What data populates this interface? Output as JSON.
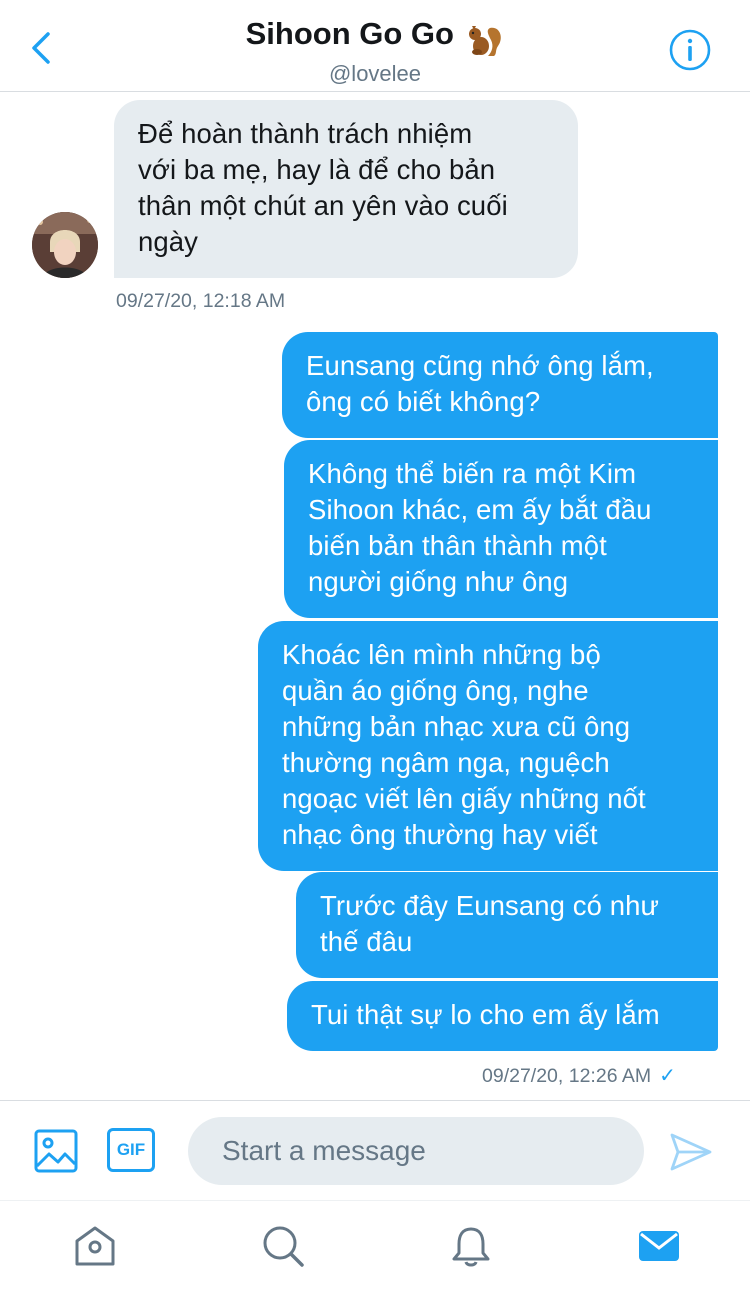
{
  "header": {
    "title": "Sihoon Go Go",
    "title_emoji": "squirrel-emoji",
    "handle": "@lovelee",
    "back_icon": "chevron-left-icon",
    "info_icon": "info-icon"
  },
  "colors": {
    "accent": "#1da1f2",
    "received_bubble": "#e6ecf0",
    "muted_text": "#657786"
  },
  "conversation": {
    "received": [
      {
        "text": "Để hoàn thành trách nhiệm\nvới ba mẹ, hay là để cho bản\nthân một chút an yên vào cuối\nngày"
      }
    ],
    "received_timestamp": "09/27/20, 12:18 AM",
    "sent": [
      {
        "text": "Eunsang cũng nhớ ông lắm,\nông có biết không?"
      },
      {
        "text": "Không thể biến ra một Kim\nSihoon khác, em ấy bắt đầu\nbiến bản thân thành một\nngười giống như ông"
      },
      {
        "text": "Khoác lên mình những bộ\nquần áo giống ông, nghe\nnhững bản nhạc xưa cũ ông\nthường ngâm nga, nguệch\nngoạc viết lên giấy những nốt\nnhạc ông thường hay viết"
      },
      {
        "text": "Trước đây Eunsang có như\nthế đâu"
      },
      {
        "text": "Tui thật sự lo cho em ấy lắm"
      }
    ],
    "sent_timestamp": "09/27/20, 12:26 AM",
    "sent_status": "✓"
  },
  "composer": {
    "placeholder": "Start a message",
    "gif_label": "GIF",
    "media_icon": "image-icon",
    "send_icon": "send-icon"
  },
  "tabbar": {
    "items": [
      {
        "icon": "home-icon",
        "active": false
      },
      {
        "icon": "search-icon",
        "active": false
      },
      {
        "icon": "bell-icon",
        "active": false
      },
      {
        "icon": "mail-icon",
        "active": true
      }
    ]
  }
}
